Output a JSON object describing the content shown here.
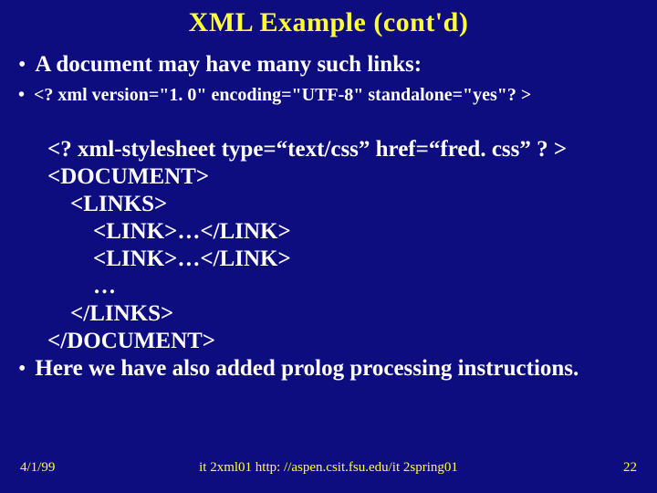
{
  "title": "XML Example (cont'd)",
  "bullets": {
    "b1": "A document may have many such links:",
    "b2": "<? xml version=\"1. 0\"  encoding=\"UTF-8\" standalone=\"yes\"? >",
    "b3": "Here we have also added prolog processing instructions."
  },
  "code": {
    "l1": "<? xml-stylesheet type=“text/css” href=“fred. css” ? >",
    "l2": "<DOCUMENT>",
    "l3": "    <LINKS>",
    "l4": "        <LINK>…</LINK>",
    "l5": "        <LINK>…</LINK>",
    "l6": "        …",
    "l7": "    </LINKS>",
    "l8": "</DOCUMENT>"
  },
  "footer": {
    "date": "4/1/99",
    "center": "it 2xml01  http: //aspen.csit.fsu.edu/it 2spring01",
    "page": "22"
  }
}
